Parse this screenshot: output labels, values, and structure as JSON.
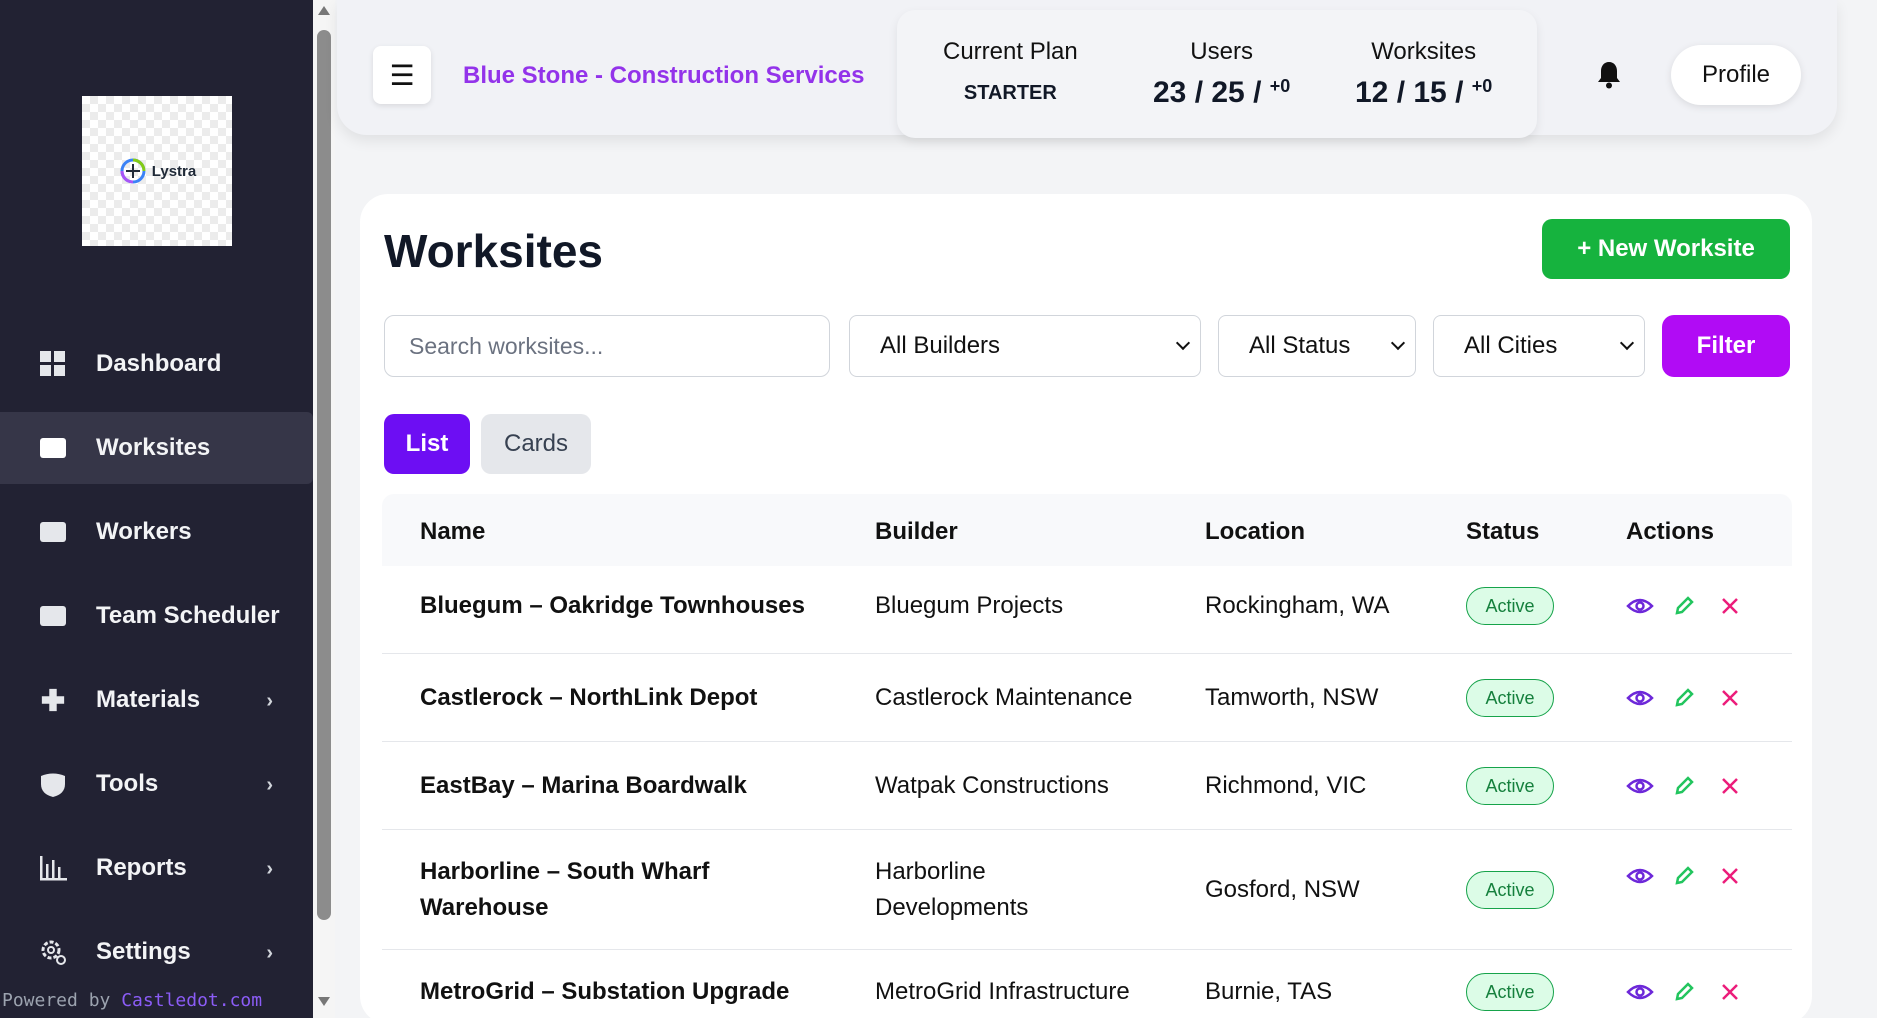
{
  "sidebar": {
    "logo_text": "Lystra",
    "items": [
      {
        "label": "Dashboard",
        "icon": "grid-icon",
        "active": false,
        "has_submenu": false
      },
      {
        "label": "Worksites",
        "icon": "window-icon",
        "active": true,
        "has_submenu": false
      },
      {
        "label": "Workers",
        "icon": "window-icon",
        "active": false,
        "has_submenu": false
      },
      {
        "label": "Team Scheduler",
        "icon": "window-icon",
        "active": false,
        "has_submenu": false
      },
      {
        "label": "Materials",
        "icon": "plus-icon",
        "active": false,
        "has_submenu": true
      },
      {
        "label": "Tools",
        "icon": "shield-icon",
        "active": false,
        "has_submenu": true
      },
      {
        "label": "Reports",
        "icon": "bar-chart-icon",
        "active": false,
        "has_submenu": true
      },
      {
        "label": "Settings",
        "icon": "gear-icon",
        "active": false,
        "has_submenu": true
      }
    ],
    "powered_prefix": "Powered by ",
    "powered_brand": "Castledot.com"
  },
  "header": {
    "menu_icon": "☰",
    "company": "Blue Stone - Construction Services",
    "plan": {
      "label": "Current Plan",
      "value": "STARTER"
    },
    "users": {
      "label": "Users",
      "value": "23 / 25 / ",
      "extra": "+0"
    },
    "worksites": {
      "label": "Worksites",
      "value": "12 / 15 / ",
      "extra": "+0"
    },
    "profile": "Profile"
  },
  "main": {
    "title": "Worksites",
    "new_button": "+ New Worksite",
    "search_placeholder": "Search worksites...",
    "filters": {
      "builders": "All Builders",
      "status": "All Status",
      "cities": "All Cities"
    },
    "filter_button": "Filter",
    "views": {
      "list": "List",
      "cards": "Cards",
      "active": "list"
    },
    "table": {
      "headers": [
        "Name",
        "Builder",
        "Location",
        "Status",
        "Actions"
      ],
      "rows": [
        {
          "name": "Bluegum – Oakridge Townhouses",
          "builder": "Bluegum Projects",
          "location": "Rockingham, WA",
          "status": "Active"
        },
        {
          "name": "Castlerock – NorthLink Depot",
          "builder": "Castlerock Maintenance",
          "location": "Tamworth, NSW",
          "status": "Active"
        },
        {
          "name": "EastBay – Marina Boardwalk",
          "builder": "Watpak Constructions",
          "location": "Richmond, VIC",
          "status": "Active"
        },
        {
          "name": "Harborline – South Wharf Warehouse",
          "builder": "Harborline Developments",
          "location": "Gosford, NSW",
          "status": "Active"
        },
        {
          "name": "MetroGrid – Substation Upgrade",
          "builder": "MetroGrid Infrastructure",
          "location": "Burnie, TAS",
          "status": "Active"
        }
      ]
    }
  },
  "colors": {
    "sidebar_bg": "#222233",
    "brand_purple": "#9333ea",
    "filter_purple": "#b10bf5",
    "list_purple": "#6d0ef3",
    "new_green": "#16b33e",
    "view_icon": "#6d28d9",
    "edit_icon": "#22c55e",
    "delete_icon": "#ec1c7a"
  }
}
